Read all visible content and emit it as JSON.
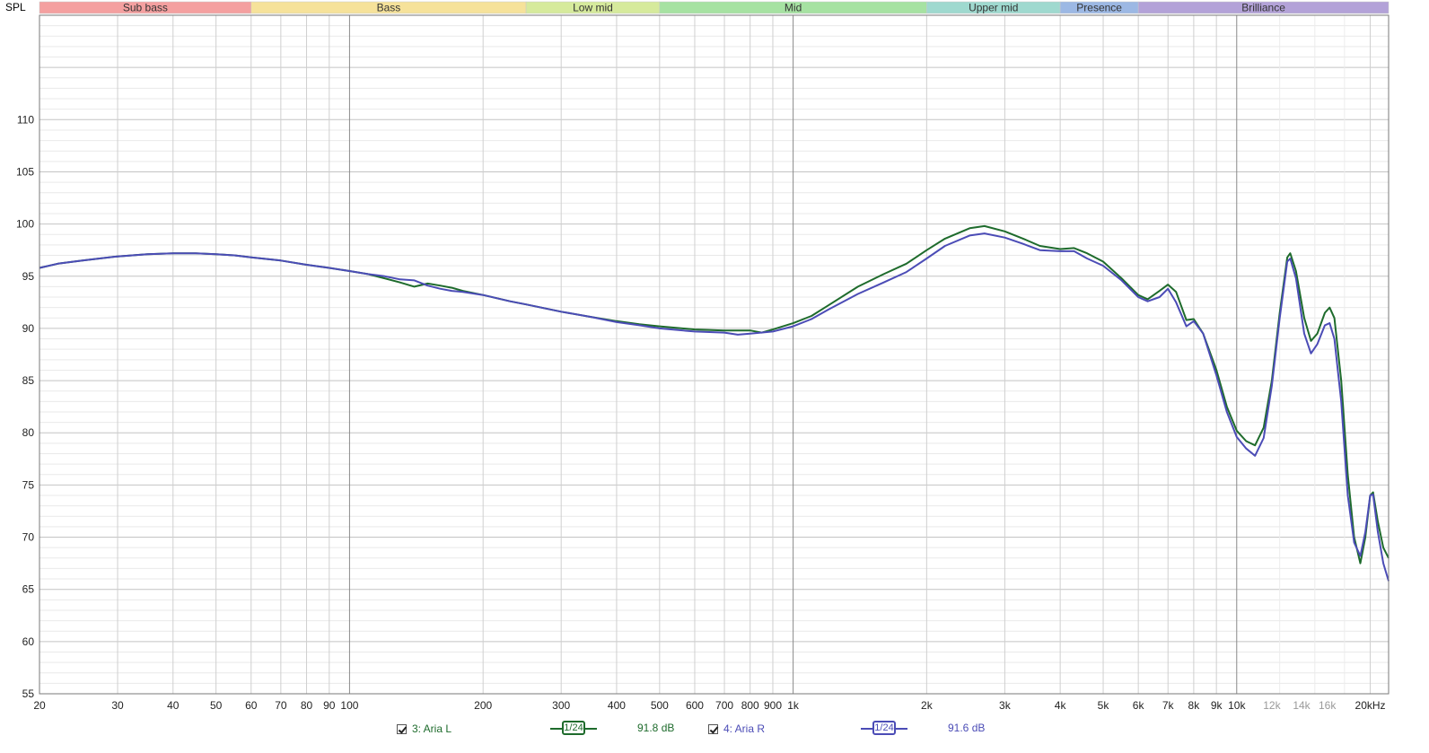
{
  "chart_data": {
    "type": "line",
    "ylabel": "SPL",
    "xlabel": "",
    "x_scale": "log",
    "xlim": [
      20,
      22000
    ],
    "ylim": [
      55,
      120
    ],
    "grid": true,
    "bands": [
      {
        "name": "Sub bass",
        "range": [
          20,
          60
        ],
        "color": "#f4a0a0"
      },
      {
        "name": "Bass",
        "range": [
          60,
          250
        ],
        "color": "#f6e29a"
      },
      {
        "name": "Low mid",
        "range": [
          250,
          500
        ],
        "color": "#d6ea9c"
      },
      {
        "name": "Mid",
        "range": [
          500,
          2000
        ],
        "color": "#a6e2a2"
      },
      {
        "name": "Upper mid",
        "range": [
          2000,
          4000
        ],
        "color": "#9fd9cf"
      },
      {
        "name": "Presence",
        "range": [
          4000,
          6000
        ],
        "color": "#9cb8e4"
      },
      {
        "name": "Brilliance",
        "range": [
          6000,
          20000
        ],
        "color": "#b3a2d8"
      }
    ],
    "x_ticks": [
      {
        "v": 20,
        "l": "20"
      },
      {
        "v": 30,
        "l": "30"
      },
      {
        "v": 40,
        "l": "40"
      },
      {
        "v": 50,
        "l": "50"
      },
      {
        "v": 60,
        "l": "60"
      },
      {
        "v": 70,
        "l": "70"
      },
      {
        "v": 80,
        "l": "80"
      },
      {
        "v": 90,
        "l": "90"
      },
      {
        "v": 100,
        "l": "100"
      },
      {
        "v": 200,
        "l": "200"
      },
      {
        "v": 300,
        "l": "300"
      },
      {
        "v": 400,
        "l": "400"
      },
      {
        "v": 500,
        "l": "500"
      },
      {
        "v": 600,
        "l": "600"
      },
      {
        "v": 700,
        "l": "700"
      },
      {
        "v": 800,
        "l": "800"
      },
      {
        "v": 900,
        "l": "900"
      },
      {
        "v": 1000,
        "l": "1k"
      },
      {
        "v": 2000,
        "l": "2k"
      },
      {
        "v": 3000,
        "l": "3k"
      },
      {
        "v": 4000,
        "l": "4k"
      },
      {
        "v": 5000,
        "l": "5k"
      },
      {
        "v": 6000,
        "l": "6k"
      },
      {
        "v": 7000,
        "l": "7k"
      },
      {
        "v": 8000,
        "l": "8k"
      },
      {
        "v": 9000,
        "l": "9k"
      },
      {
        "v": 10000,
        "l": "10k"
      },
      {
        "v": 12000,
        "l": "12k",
        "muted": true
      },
      {
        "v": 14000,
        "l": "14k",
        "muted": true
      },
      {
        "v": 16000,
        "l": "16k",
        "muted": true
      },
      {
        "v": 20000,
        "l": "20kHz"
      }
    ],
    "y_ticks": [
      55,
      60,
      65,
      70,
      75,
      80,
      85,
      90,
      95,
      100,
      105,
      110
    ],
    "series": [
      {
        "name": "3: Aria L",
        "color": "#1e6b2c",
        "smoothing": "1/24",
        "level": "91.8 dB",
        "points": [
          [
            20,
            95.8
          ],
          [
            22,
            96.2
          ],
          [
            25,
            96.5
          ],
          [
            30,
            96.9
          ],
          [
            35,
            97.1
          ],
          [
            40,
            97.2
          ],
          [
            45,
            97.2
          ],
          [
            50,
            97.1
          ],
          [
            55,
            97.0
          ],
          [
            60,
            96.8
          ],
          [
            70,
            96.5
          ],
          [
            80,
            96.1
          ],
          [
            90,
            95.8
          ],
          [
            100,
            95.5
          ],
          [
            110,
            95.2
          ],
          [
            120,
            94.8
          ],
          [
            130,
            94.4
          ],
          [
            140,
            94.0
          ],
          [
            150,
            94.3
          ],
          [
            160,
            94.1
          ],
          [
            170,
            93.9
          ],
          [
            180,
            93.6
          ],
          [
            200,
            93.2
          ],
          [
            230,
            92.6
          ],
          [
            250,
            92.3
          ],
          [
            300,
            91.6
          ],
          [
            350,
            91.1
          ],
          [
            400,
            90.7
          ],
          [
            450,
            90.4
          ],
          [
            500,
            90.2
          ],
          [
            600,
            89.9
          ],
          [
            700,
            89.8
          ],
          [
            800,
            89.8
          ],
          [
            850,
            89.6
          ],
          [
            900,
            89.9
          ],
          [
            1000,
            90.5
          ],
          [
            1100,
            91.2
          ],
          [
            1200,
            92.2
          ],
          [
            1400,
            94.0
          ],
          [
            1600,
            95.2
          ],
          [
            1800,
            96.2
          ],
          [
            2000,
            97.5
          ],
          [
            2200,
            98.6
          ],
          [
            2500,
            99.6
          ],
          [
            2700,
            99.8
          ],
          [
            3000,
            99.3
          ],
          [
            3300,
            98.6
          ],
          [
            3600,
            97.9
          ],
          [
            4000,
            97.6
          ],
          [
            4300,
            97.7
          ],
          [
            4600,
            97.2
          ],
          [
            5000,
            96.4
          ],
          [
            5500,
            94.8
          ],
          [
            6000,
            93.2
          ],
          [
            6300,
            92.8
          ],
          [
            6700,
            93.6
          ],
          [
            7000,
            94.2
          ],
          [
            7300,
            93.5
          ],
          [
            7700,
            90.8
          ],
          [
            8000,
            90.9
          ],
          [
            8400,
            89.5
          ],
          [
            9000,
            86.0
          ],
          [
            9500,
            82.5
          ],
          [
            10000,
            80.2
          ],
          [
            10500,
            79.2
          ],
          [
            11000,
            78.8
          ],
          [
            11500,
            80.5
          ],
          [
            12000,
            85.0
          ],
          [
            12500,
            91.5
          ],
          [
            13000,
            96.8
          ],
          [
            13200,
            97.2
          ],
          [
            13600,
            95.5
          ],
          [
            14200,
            91.0
          ],
          [
            14700,
            88.8
          ],
          [
            15200,
            89.5
          ],
          [
            15800,
            91.5
          ],
          [
            16200,
            92.0
          ],
          [
            16600,
            91.0
          ],
          [
            17200,
            85.0
          ],
          [
            17800,
            76.0
          ],
          [
            18400,
            70.0
          ],
          [
            19000,
            67.5
          ],
          [
            19500,
            70.0
          ],
          [
            20000,
            74.0
          ],
          [
            20300,
            74.3
          ],
          [
            20800,
            71.5
          ],
          [
            21400,
            69.0
          ],
          [
            22000,
            68.0
          ]
        ]
      },
      {
        "name": "4: Aria R",
        "color": "#4b4cb6",
        "smoothing": "1/24",
        "level": "91.6 dB",
        "points": [
          [
            20,
            95.8
          ],
          [
            22,
            96.2
          ],
          [
            25,
            96.5
          ],
          [
            30,
            96.9
          ],
          [
            35,
            97.1
          ],
          [
            40,
            97.2
          ],
          [
            45,
            97.2
          ],
          [
            50,
            97.1
          ],
          [
            55,
            97.0
          ],
          [
            60,
            96.8
          ],
          [
            70,
            96.5
          ],
          [
            80,
            96.1
          ],
          [
            90,
            95.8
          ],
          [
            100,
            95.5
          ],
          [
            110,
            95.2
          ],
          [
            120,
            95.0
          ],
          [
            130,
            94.7
          ],
          [
            140,
            94.6
          ],
          [
            150,
            94.1
          ],
          [
            160,
            93.8
          ],
          [
            170,
            93.6
          ],
          [
            180,
            93.5
          ],
          [
            200,
            93.2
          ],
          [
            230,
            92.6
          ],
          [
            250,
            92.3
          ],
          [
            300,
            91.6
          ],
          [
            350,
            91.1
          ],
          [
            400,
            90.6
          ],
          [
            450,
            90.3
          ],
          [
            500,
            90.0
          ],
          [
            600,
            89.7
          ],
          [
            700,
            89.6
          ],
          [
            750,
            89.4
          ],
          [
            800,
            89.5
          ],
          [
            900,
            89.7
          ],
          [
            1000,
            90.2
          ],
          [
            1100,
            90.9
          ],
          [
            1200,
            91.8
          ],
          [
            1400,
            93.3
          ],
          [
            1600,
            94.4
          ],
          [
            1800,
            95.4
          ],
          [
            2000,
            96.7
          ],
          [
            2200,
            97.9
          ],
          [
            2500,
            98.9
          ],
          [
            2700,
            99.1
          ],
          [
            3000,
            98.7
          ],
          [
            3300,
            98.1
          ],
          [
            3600,
            97.5
          ],
          [
            4000,
            97.4
          ],
          [
            4300,
            97.4
          ],
          [
            4600,
            96.7
          ],
          [
            5000,
            96.0
          ],
          [
            5500,
            94.6
          ],
          [
            6000,
            93.0
          ],
          [
            6300,
            92.6
          ],
          [
            6700,
            93.0
          ],
          [
            7000,
            93.8
          ],
          [
            7300,
            92.5
          ],
          [
            7700,
            90.2
          ],
          [
            8000,
            90.7
          ],
          [
            8400,
            89.5
          ],
          [
            9000,
            85.5
          ],
          [
            9500,
            82.0
          ],
          [
            10000,
            79.6
          ],
          [
            10500,
            78.5
          ],
          [
            11000,
            77.8
          ],
          [
            11500,
            79.5
          ],
          [
            12000,
            84.5
          ],
          [
            12500,
            91.0
          ],
          [
            13000,
            96.4
          ],
          [
            13200,
            96.7
          ],
          [
            13600,
            94.8
          ],
          [
            14200,
            89.5
          ],
          [
            14700,
            87.6
          ],
          [
            15200,
            88.5
          ],
          [
            15800,
            90.3
          ],
          [
            16200,
            90.5
          ],
          [
            16600,
            89.0
          ],
          [
            17200,
            83.0
          ],
          [
            17800,
            74.0
          ],
          [
            18400,
            69.5
          ],
          [
            19000,
            68.2
          ],
          [
            19500,
            70.5
          ],
          [
            20000,
            74.0
          ],
          [
            20300,
            74.1
          ],
          [
            20800,
            70.5
          ],
          [
            21400,
            67.5
          ],
          [
            22000,
            65.8
          ]
        ]
      }
    ]
  },
  "legend": [
    {
      "label": "3: Aria L",
      "checked": true,
      "smoothing": "1/24",
      "level": "91.8 dB",
      "color": "#1e6b2c"
    },
    {
      "label": "4: Aria R",
      "checked": true,
      "smoothing": "1/24",
      "level": "91.6 dB",
      "color": "#4b4cb6"
    }
  ]
}
